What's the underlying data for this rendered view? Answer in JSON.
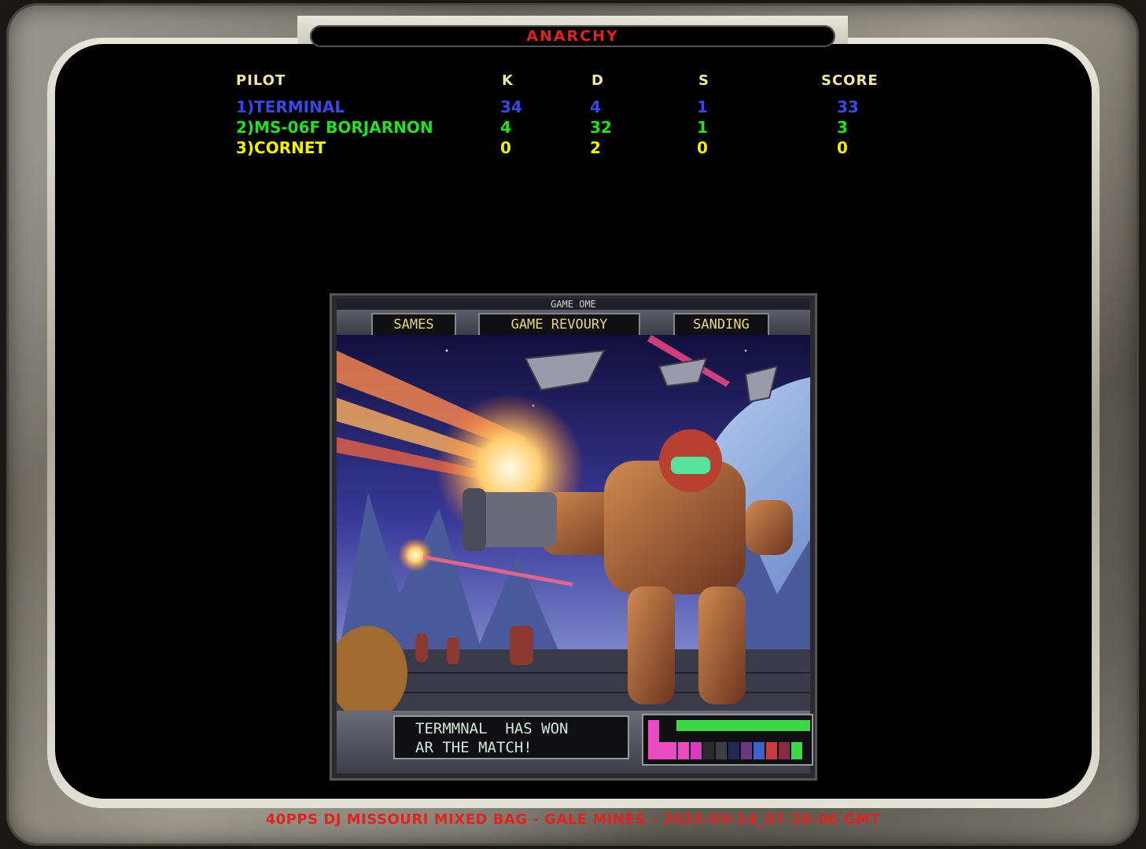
{
  "title": "ANARCHY",
  "scoreboard": {
    "headers": {
      "pilot": "PILOT",
      "k": "K",
      "d": "D",
      "s": "S",
      "score": "SCORE"
    },
    "rows": [
      {
        "pilot": "1)TERMINAL",
        "k": "34",
        "d": "4",
        "s": "1",
        "score": "33",
        "color": "#3a46e8"
      },
      {
        "pilot": "2)MS-06F BORJARNON",
        "k": "4",
        "d": "32",
        "s": "1",
        "score": "3",
        "color": "#25e020"
      },
      {
        "pilot": "3)CORNET",
        "k": "0",
        "d": "2",
        "s": "0",
        "score": "0",
        "color": "#f0f000"
      }
    ]
  },
  "art": {
    "top_strip": "GAME OME",
    "buttons": [
      "SAMES",
      "GAME REVOURY",
      "SANDING"
    ],
    "message": "TERMMNAL  HAS WON\nAR THE MATCH!",
    "meter_colors": [
      "#e84cc0",
      "#d83cc0",
      "#2a2a30",
      "#3c3e48",
      "#1e2a50",
      "#6a3a80",
      "#3e64c8",
      "#c83c3c",
      "#8a2a40",
      "#3cd848",
      "#d83c3c",
      "#e84c80"
    ]
  },
  "footer": "40PPS DJ MISSOURI MIXED BAG - GALE MINES - 2025-09-14_07-28-06 GMT"
}
